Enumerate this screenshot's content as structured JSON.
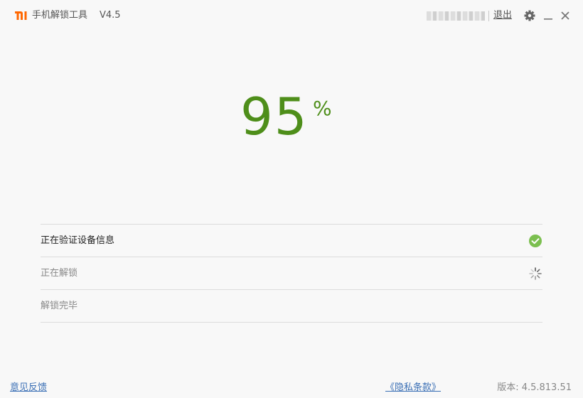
{
  "window": {
    "title": "手机解锁工具",
    "version": "V4.5"
  },
  "header": {
    "logout_label": "退出"
  },
  "icons": {
    "logo": "mi-logo-icon",
    "settings": "gear-icon",
    "minimize": "minimize-icon",
    "close": "close-icon",
    "done": "check-circle-icon",
    "loading": "spinner-icon"
  },
  "progress": {
    "value": "95",
    "unit": "%"
  },
  "steps": [
    {
      "label": "正在验证设备信息",
      "status": "done"
    },
    {
      "label": "正在解锁",
      "status": "in-progress"
    },
    {
      "label": "解锁完毕",
      "status": "pending"
    }
  ],
  "footer": {
    "feedback_label": "意见反馈",
    "privacy_label": "《隐私条款》",
    "version_label": "版本: 4.5.813.51"
  },
  "colors": {
    "brand": "#ff6700",
    "progress": "#4e8e1a",
    "done_check": "#7bbf4f",
    "link": "#3a6fb5"
  }
}
